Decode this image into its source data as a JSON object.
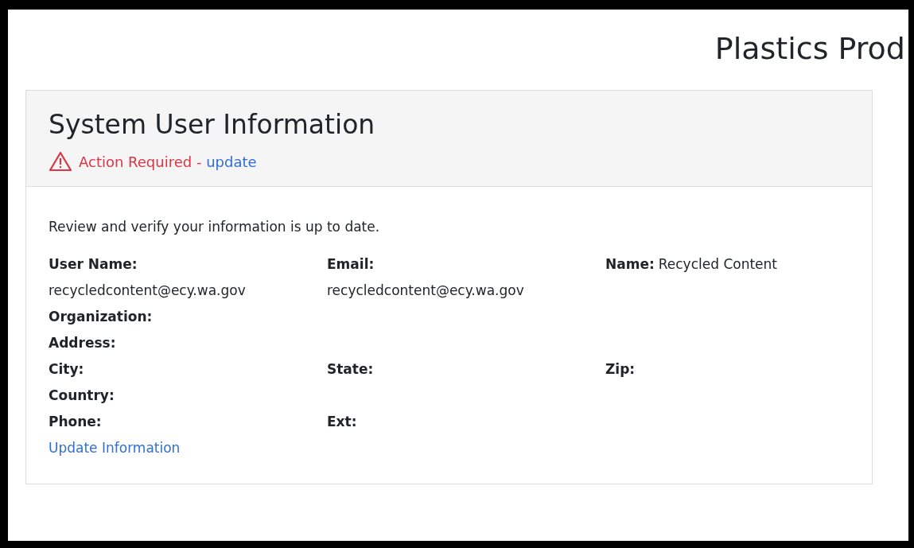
{
  "page_title": "Plastics Prod",
  "card": {
    "title": "System User Information",
    "alert": {
      "text": "Action Required - ",
      "link": "update"
    },
    "intro": "Review and verify your information is up to date.",
    "rows": [
      [
        {
          "label": "User Name:",
          "value": "recycledcontent@ecy.wa.gov",
          "kind": "stacked"
        },
        {
          "label": "Email:",
          "value": "recycledcontent@ecy.wa.gov",
          "kind": "stacked"
        },
        {
          "label": "Name:",
          "value": "Recycled Content",
          "kind": "inline"
        }
      ],
      [
        {
          "label": "Organization:",
          "kind": "inline"
        }
      ],
      [
        {
          "label": "Address:",
          "kind": "inline"
        }
      ],
      [
        {
          "label": "City:",
          "kind": "inline"
        },
        {
          "label": "State:",
          "kind": "inline"
        },
        {
          "label": "Zip:",
          "kind": "inline"
        }
      ],
      [
        {
          "label": "Country:",
          "kind": "inline"
        }
      ],
      [
        {
          "label": "Phone:",
          "kind": "inline"
        },
        {
          "label": "Ext:",
          "kind": "inline"
        }
      ]
    ],
    "update_link": "Update Information"
  }
}
